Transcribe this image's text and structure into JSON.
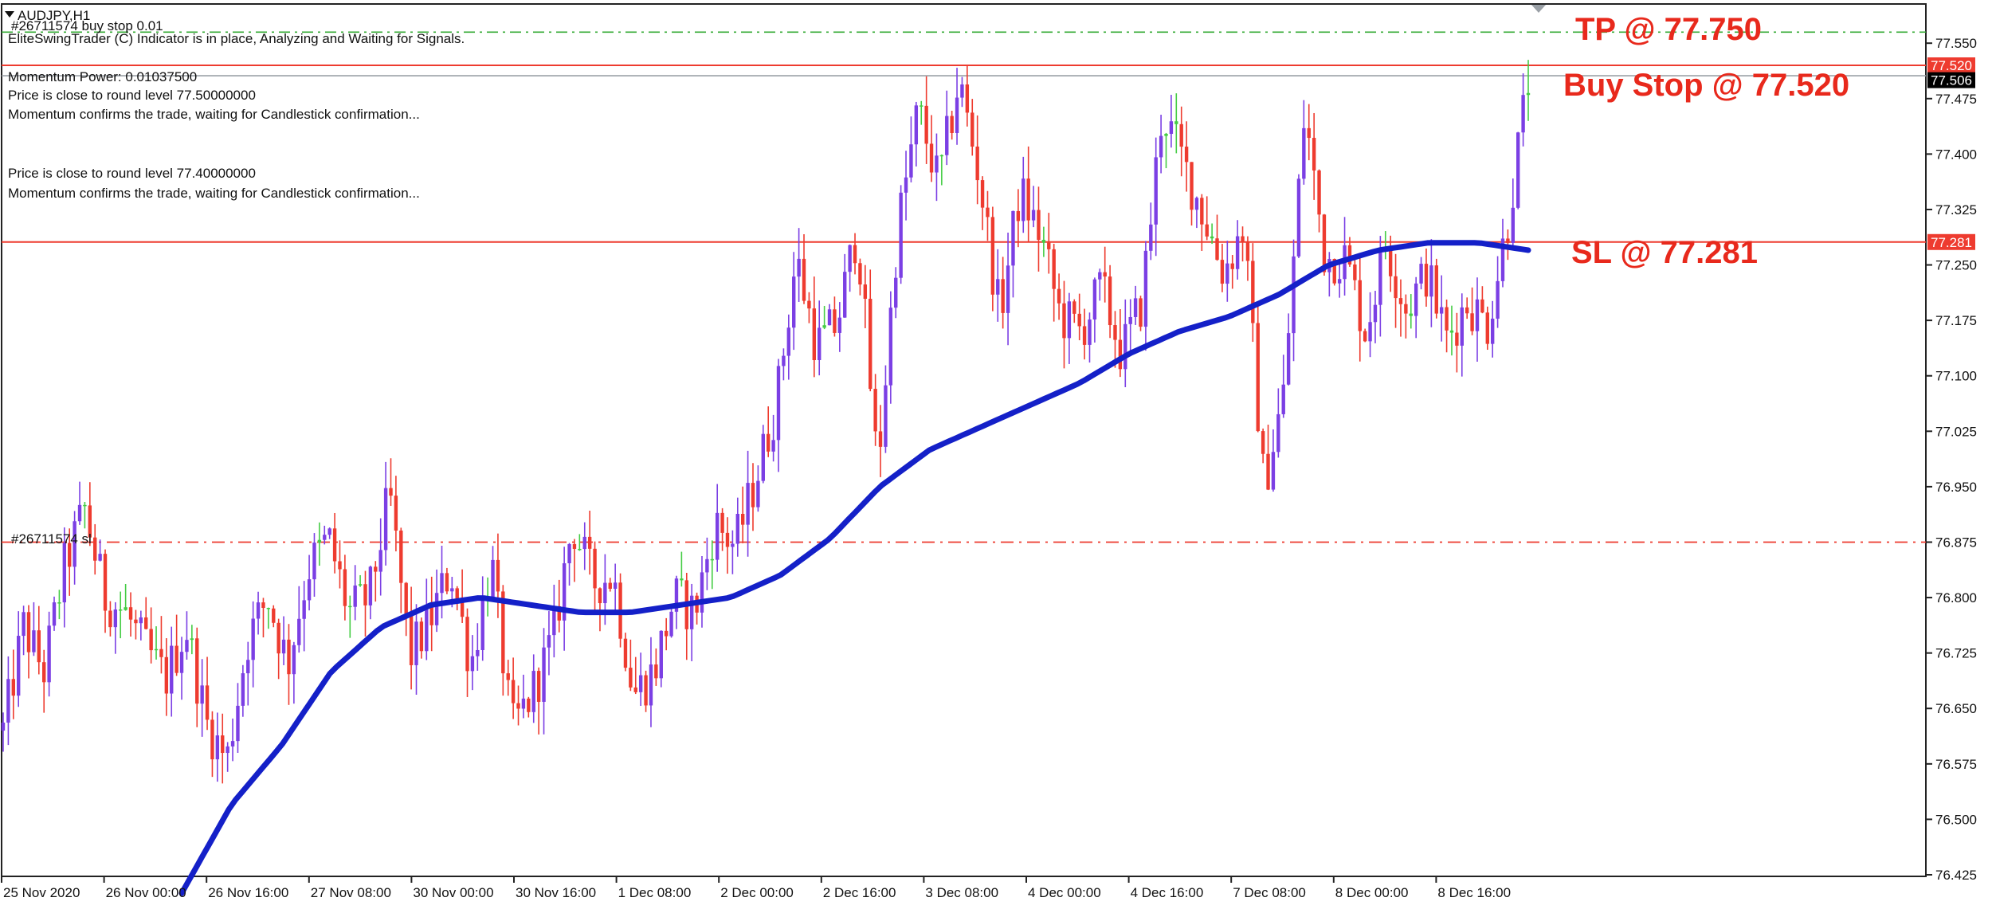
{
  "window": {
    "title": "AUDJPY,H1",
    "order_label": "#26711574 buy stop 0.01",
    "indicator_status": "EliteSwingTrader (C) Indicator is in place, Analyzing and Waiting for Signals.",
    "momentum_power": "Momentum Power: 0.01037500",
    "signal_1_line_1": "Price is close to round level 77.50000000",
    "signal_1_line_2": "Momentum confirms the trade, waiting for Candlestick confirmation...",
    "signal_2_line_1": "Price is close to round level 77.40000000",
    "signal_2_line_2": "Momentum confirms the trade, waiting for Candlestick confirmation...",
    "sl_order_label": "#26711574 sl"
  },
  "annotations": {
    "tp": "TP @ 77.750",
    "buy_stop": "Buy Stop @ 77.520",
    "sl": "SL @ 77.281"
  },
  "price_tags": {
    "buy_stop": "77.520",
    "bid": "77.506",
    "sl": "77.281"
  },
  "colors": {
    "bull_candle": "#7b3fe4",
    "bear_candle": "#ee3b2f",
    "moving_average": "#1420c8",
    "sl_line": "#ee3b2f",
    "tp_line": "#33aa33",
    "annotation_text": "#e8291c",
    "neutral_candle": "#44cc44"
  },
  "chart_data": {
    "type": "candlestick",
    "symbol": "AUDJPY",
    "timeframe": "H1",
    "ylim": [
      76.425,
      77.575
    ],
    "y_ticks": [
      "77.550",
      "77.475",
      "77.400",
      "77.325",
      "77.250",
      "77.175",
      "77.100",
      "77.025",
      "76.950",
      "76.875",
      "76.800",
      "76.725",
      "76.650",
      "76.575",
      "76.500",
      "76.425"
    ],
    "x_tick_labels": [
      "25 Nov 2020",
      "26 Nov 00:00",
      "26 Nov 16:00",
      "27 Nov 08:00",
      "30 Nov 00:00",
      "30 Nov 16:00",
      "1 Dec 08:00",
      "2 Dec 00:00",
      "2 Dec 16:00",
      "3 Dec 08:00",
      "4 Dec 00:00",
      "4 Dec 16:00",
      "7 Dec 08:00",
      "8 Dec 00:00",
      "8 Dec 16:00"
    ],
    "levels": {
      "tp": 77.565,
      "buy_stop": 77.52,
      "current_price": 77.506,
      "sl": 77.281,
      "sl_order": 76.875
    },
    "close_path": [
      76.62,
      76.76,
      76.7,
      76.84,
      76.92,
      76.8,
      76.78,
      76.73,
      76.69,
      76.76,
      76.63,
      76.58,
      76.74,
      76.8,
      76.71,
      76.84,
      76.88,
      76.78,
      76.8,
      76.94,
      76.72,
      76.77,
      76.84,
      76.71,
      76.85,
      76.62,
      76.67,
      76.74,
      76.9,
      76.82,
      76.83,
      76.67,
      76.7,
      76.8,
      76.78,
      76.9,
      76.87,
      76.96,
      77.06,
      77.26,
      77.14,
      77.17,
      77.3,
      76.97,
      77.3,
      77.46,
      77.36,
      77.5,
      77.37,
      77.18,
      77.35,
      77.29,
      77.18,
      77.16,
      77.22,
      77.13,
      77.2,
      77.46,
      77.39,
      77.32,
      77.24,
      77.3,
      76.95,
      77.08,
      77.46,
      77.26,
      77.26,
      77.16,
      77.28,
      77.19,
      77.24,
      77.15,
      77.2,
      77.17,
      77.31,
      77.5
    ],
    "ma_path": [
      76.4,
      76.52,
      76.6,
      76.7,
      76.76,
      76.79,
      76.8,
      76.79,
      76.78,
      76.78,
      76.79,
      76.8,
      76.83,
      76.88,
      76.95,
      77.0,
      77.03,
      77.06,
      77.09,
      77.13,
      77.16,
      77.18,
      77.21,
      77.25,
      77.27,
      77.28,
      77.28,
      77.27
    ],
    "candle_count": 300
  }
}
